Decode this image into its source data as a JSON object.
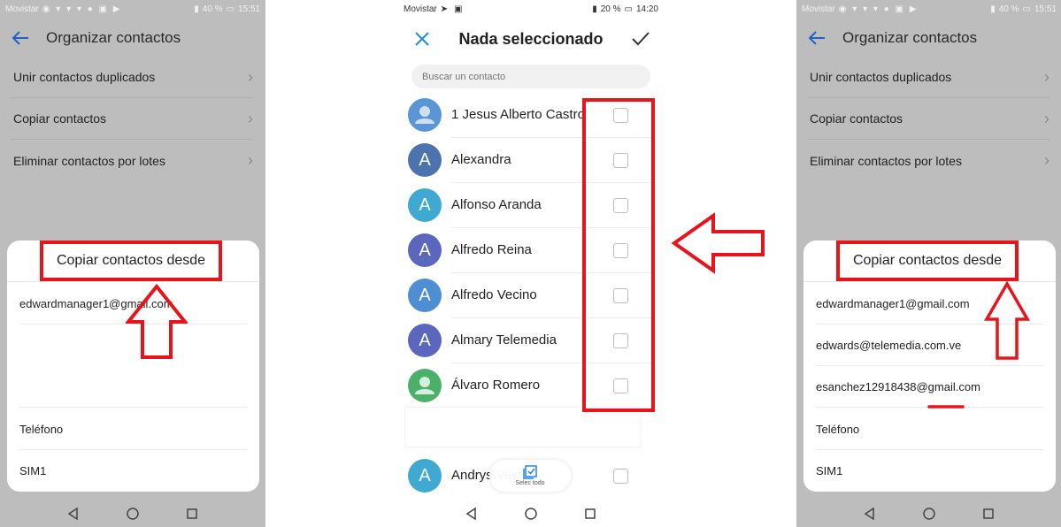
{
  "left_phone": {
    "status_bar": {
      "carrier": "Movistar",
      "battery": "40 %",
      "time": "15:51"
    },
    "toolbar_title": "Organizar contactos",
    "menu": [
      {
        "label": "Unir contactos duplicados"
      },
      {
        "label": "Copiar contactos"
      },
      {
        "label": "Eliminar contactos por lotes"
      }
    ],
    "dialog": {
      "title": "Copiar contactos desde",
      "items": [
        "edwardmanager1@gmail.com",
        "Teléfono",
        "SIM1"
      ]
    }
  },
  "middle_phone": {
    "status_bar": {
      "carrier": "Movistar",
      "battery": "20 %",
      "time": "14:20"
    },
    "title": "Nada seleccionado",
    "search_placeholder": "Buscar un contacto",
    "contacts": [
      {
        "name": "1 Jesus Alberto Castro",
        "initial": "",
        "color": "#5a95d6"
      },
      {
        "name": "Alexandra",
        "initial": "A",
        "color": "#4c73ad"
      },
      {
        "name": "Alfonso Aranda",
        "initial": "A",
        "color": "#3fa9d2"
      },
      {
        "name": "Alfredo Reina",
        "initial": "A",
        "color": "#5b67bc"
      },
      {
        "name": "Alfredo Vecino",
        "initial": "A",
        "color": "#4e8fd4"
      },
      {
        "name": "Almary Telemedia",
        "initial": "A",
        "color": "#5b67bc"
      },
      {
        "name": "Álvaro Romero",
        "initial": "",
        "color": "#4db06a"
      }
    ],
    "last_contact": {
      "name": "Andrys Veci",
      "initial": "A",
      "color": "#3fa9d2"
    },
    "select_all_label": "Selec todo"
  },
  "right_phone": {
    "status_bar": {
      "carrier": "Movistar",
      "battery": "40 %",
      "time": "15:51"
    },
    "toolbar_title": "Organizar contactos",
    "menu": [
      {
        "label": "Unir contactos duplicados"
      },
      {
        "label": "Copiar contactos"
      },
      {
        "label": "Eliminar contactos por lotes"
      }
    ],
    "dialog": {
      "title": "Copiar contactos desde",
      "items": [
        "edwardmanager1@gmail.com",
        "edwards@telemedia.com.ve",
        "esanchez12918438@gmail.com",
        "Teléfono",
        "SIM1"
      ]
    }
  },
  "colors": {
    "annotation_red": "#e8141c",
    "accent_blue": "#1e63c4"
  }
}
